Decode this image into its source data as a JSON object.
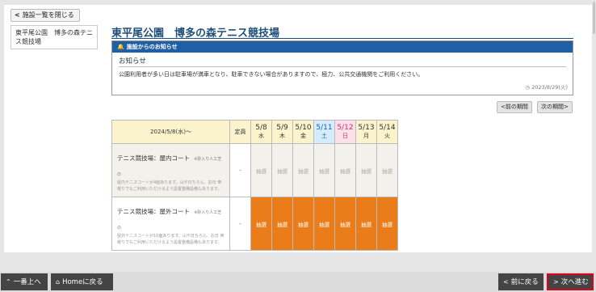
{
  "sidebar": {
    "close_button": "施設一覧を閉じる",
    "items": [
      {
        "label": "東平尾公園　博多の森テニス競技場"
      }
    ]
  },
  "facility": {
    "title": "東平尾公園　博多の森テニス競技場"
  },
  "notice": {
    "header": "施設からのお知らせ",
    "subtitle": "お知らせ",
    "body": "公園利用者が多い日は駐車場が満車となり、駐車できない場合がありますので、極力、公共交通機関をご利用ください。",
    "date": "2023/8/29(火)"
  },
  "period": {
    "prev_label": "前の期間",
    "next_label": "次の期間"
  },
  "table": {
    "head_date": "2024/5/8(水)〜",
    "capacity_header": "定員",
    "days": [
      {
        "date": "5/8",
        "dow": "水",
        "type": "weekday"
      },
      {
        "date": "5/9",
        "dow": "木",
        "type": "weekday"
      },
      {
        "date": "5/10",
        "dow": "金",
        "type": "weekday"
      },
      {
        "date": "5/11",
        "dow": "土",
        "type": "sat"
      },
      {
        "date": "5/12",
        "dow": "日",
        "type": "sun"
      },
      {
        "date": "5/13",
        "dow": "月",
        "type": "weekday"
      },
      {
        "date": "5/14",
        "dow": "火",
        "type": "weekday"
      }
    ],
    "rows": [
      {
        "name": "テニス競技場：屋内コート",
        "note": "※砂入り人工芝の",
        "desc": "屋内テニスコートが4面あります。山や日ちろん、お日 帝曜りでもご利用いただけるよう設置整備設備もあります。",
        "capacity": "-",
        "status": "closed",
        "cells": [
          "抽選",
          "抽選",
          "抽選",
          "抽選",
          "抽選",
          "抽選",
          "抽選"
        ]
      },
      {
        "name": "テニス競技場：屋外コート",
        "note": "※砂入り人工芝の",
        "desc": "屋外テニスコートが10面あります。山や日ちろん、お日 帝曜りでもご利用いただけるよう設置整備設備もあります。",
        "capacity": "-",
        "status": "open",
        "cells": [
          "抽選",
          "抽選",
          "抽選",
          "抽選",
          "抽選",
          "抽選",
          "抽選"
        ]
      }
    ]
  },
  "footer": {
    "top_label": "一番上へ",
    "home_label": "Homeに戻る",
    "back_label": "前に戻る",
    "next_label": "次へ進む"
  },
  "colors": {
    "title": "#1f4e79",
    "notice_header": "#1e5fa8",
    "open_cell": "#ea7d1a",
    "header_bg": "#fbf3cc",
    "saturday_bg": "#d4ecfb",
    "sunday_bg": "#fbe0ea",
    "next_highlight": "#e0001b"
  },
  "icons": {
    "close": "chevron-left-icon",
    "notice": "bell-icon",
    "date": "clock-icon",
    "top": "double-chevron-up-icon",
    "home": "home-icon",
    "back": "chevron-left-icon",
    "next": "chevron-right-icon"
  }
}
